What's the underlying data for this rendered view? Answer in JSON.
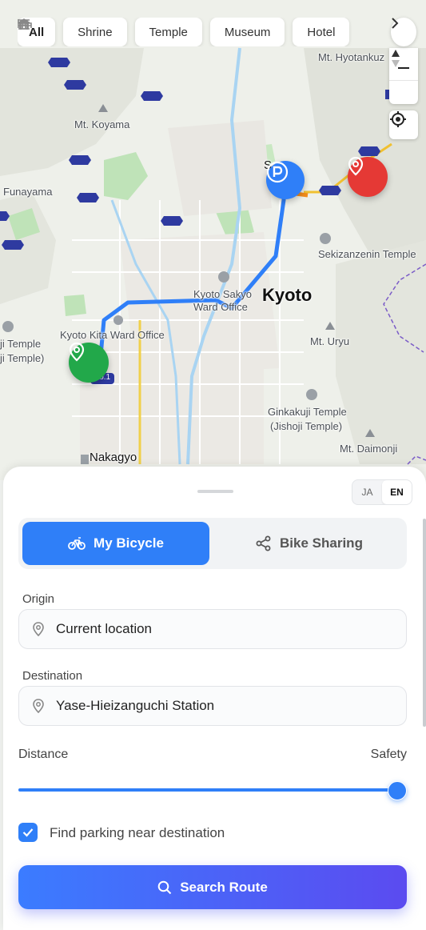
{
  "filters": [
    {
      "label": "All",
      "icon": ""
    },
    {
      "label": "Shrine",
      "icon": "torii-icon"
    },
    {
      "label": "Temple",
      "icon": "temple-icon"
    },
    {
      "label": "Museum",
      "icon": "museum-icon"
    },
    {
      "label": "Hotel",
      "icon": "bed-icon"
    }
  ],
  "map": {
    "labels": {
      "hyotankuzaki": "Mt. Hyotankuz",
      "koyama": "Mt. Koyama",
      "funayama": "Funayama",
      "sakyo_top": "Sa  o",
      "sekizanzenin": "Sekizanzenin Temple",
      "sakyo_office": "Kyoto Sakyo Ward Office",
      "kyoto": "Kyoto",
      "kita_office": "Kyoto Kita Ward Office",
      "ji_temple": "ji Temple",
      "ji_temple_jp": "ji Temple)",
      "uryu": "Mt. Uryu",
      "ginkakuji": "Ginkakuji Temple",
      "ginkakuji_jp": "(Jishoji Temple)",
      "daimonji": "Mt. Daimonji",
      "nakagyo": "Nakagyo",
      "route_no": "No.1"
    },
    "colors": {
      "route": "#2f7ff8",
      "origin_pin": "#22a84a",
      "parking_pin": "#2f7ff8",
      "destination_pin": "#e53935"
    }
  },
  "sheet": {
    "lang_ja": "JA",
    "lang_en": "EN",
    "mode_my_bicycle": "My Bicycle",
    "mode_bike_sharing": "Bike Sharing",
    "origin_label": "Origin",
    "origin_value": "Current location",
    "destination_label": "Destination",
    "destination_value": "Yase-Hieizanguchi Station",
    "slider_left": "Distance",
    "slider_right": "Safety",
    "slider_value": 1.0,
    "parking_checkbox": "Find parking near destination",
    "parking_checked": true,
    "search_button": "Search Route"
  }
}
